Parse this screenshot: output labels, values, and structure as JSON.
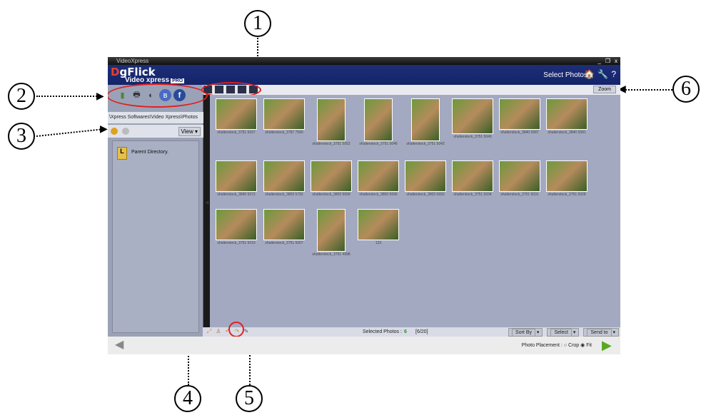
{
  "callouts": [
    "1",
    "2",
    "3",
    "4",
    "5",
    "6"
  ],
  "app": {
    "window_title": "VideoXpress",
    "window_buttons": [
      "_",
      "❐",
      "x"
    ],
    "logo_main": "DgFlick",
    "logo_d": "D",
    "logo_rest": "gFlick",
    "logo_sub": "Video xpress",
    "logo_badge": "PRO",
    "header_title": "Select Photos",
    "header_icons": [
      "home-icon",
      "wrench-icon",
      "help-icon"
    ],
    "header_icon_glyphs": [
      "🏠",
      "🔧",
      "?"
    ],
    "zoom_label": "Zoom"
  },
  "left_panel": {
    "share_icons": [
      "usb-icon",
      "printer-icon",
      "burn-icon",
      "bluetooth-icon",
      "facebook-icon"
    ],
    "share_glyphs": [
      "▮",
      "🖶",
      "◐",
      "ʙ",
      "f"
    ],
    "path": "\\Xpress Softwares\\Video Xpress\\Photos",
    "view_label": "View",
    "parent_dir_label": "Parent Directory.",
    "parent_dir_glyph": "L"
  },
  "photos": [
    {
      "label": "shutterstock_3751 5037"
    },
    {
      "label": "shutterstock_3787 7590"
    },
    {
      "label": "shutterstock_3751 5052"
    },
    {
      "label": "shutterstock_3751 5046"
    },
    {
      "label": "shutterstock_3751 5043"
    },
    {
      "label": "shutterstock_3751 5040"
    },
    {
      "label": "shutterstock_3840 5587"
    },
    {
      "label": "shutterstock_3840 5581"
    },
    {
      "label": "shutterstock_3840 5572"
    },
    {
      "label": "shutterstock_3803 5792"
    },
    {
      "label": "shutterstock_3803 5699"
    },
    {
      "label": "shutterstock_3803 5696"
    },
    {
      "label": "shutterstock_3803 5693"
    },
    {
      "label": "shutterstock_3751 5034"
    },
    {
      "label": "shutterstock_3751 5031"
    },
    {
      "label": "shutterstock_3751 5028"
    },
    {
      "label": "shutterstock_3751 5019"
    },
    {
      "label": "shutterstock_3751 5007"
    },
    {
      "label": "shutterstock_3751 4998"
    },
    {
      "label": "123"
    }
  ],
  "bottom_bar": {
    "selected_label": "Selected Photos :",
    "selected_count": "6",
    "selected_fraction": "[6/20]",
    "sort_by": "Sort By",
    "select": "Select",
    "send_to": "Send to",
    "tool_icons": [
      "resize-icon",
      "person-icon",
      "rotate-left-icon",
      "rotate-right-icon",
      "brush-icon"
    ]
  },
  "footer": {
    "placement_label": "Photo Placement :",
    "crop_label": "Crop",
    "fit_label": "Fit",
    "selected_option": "Fit"
  }
}
